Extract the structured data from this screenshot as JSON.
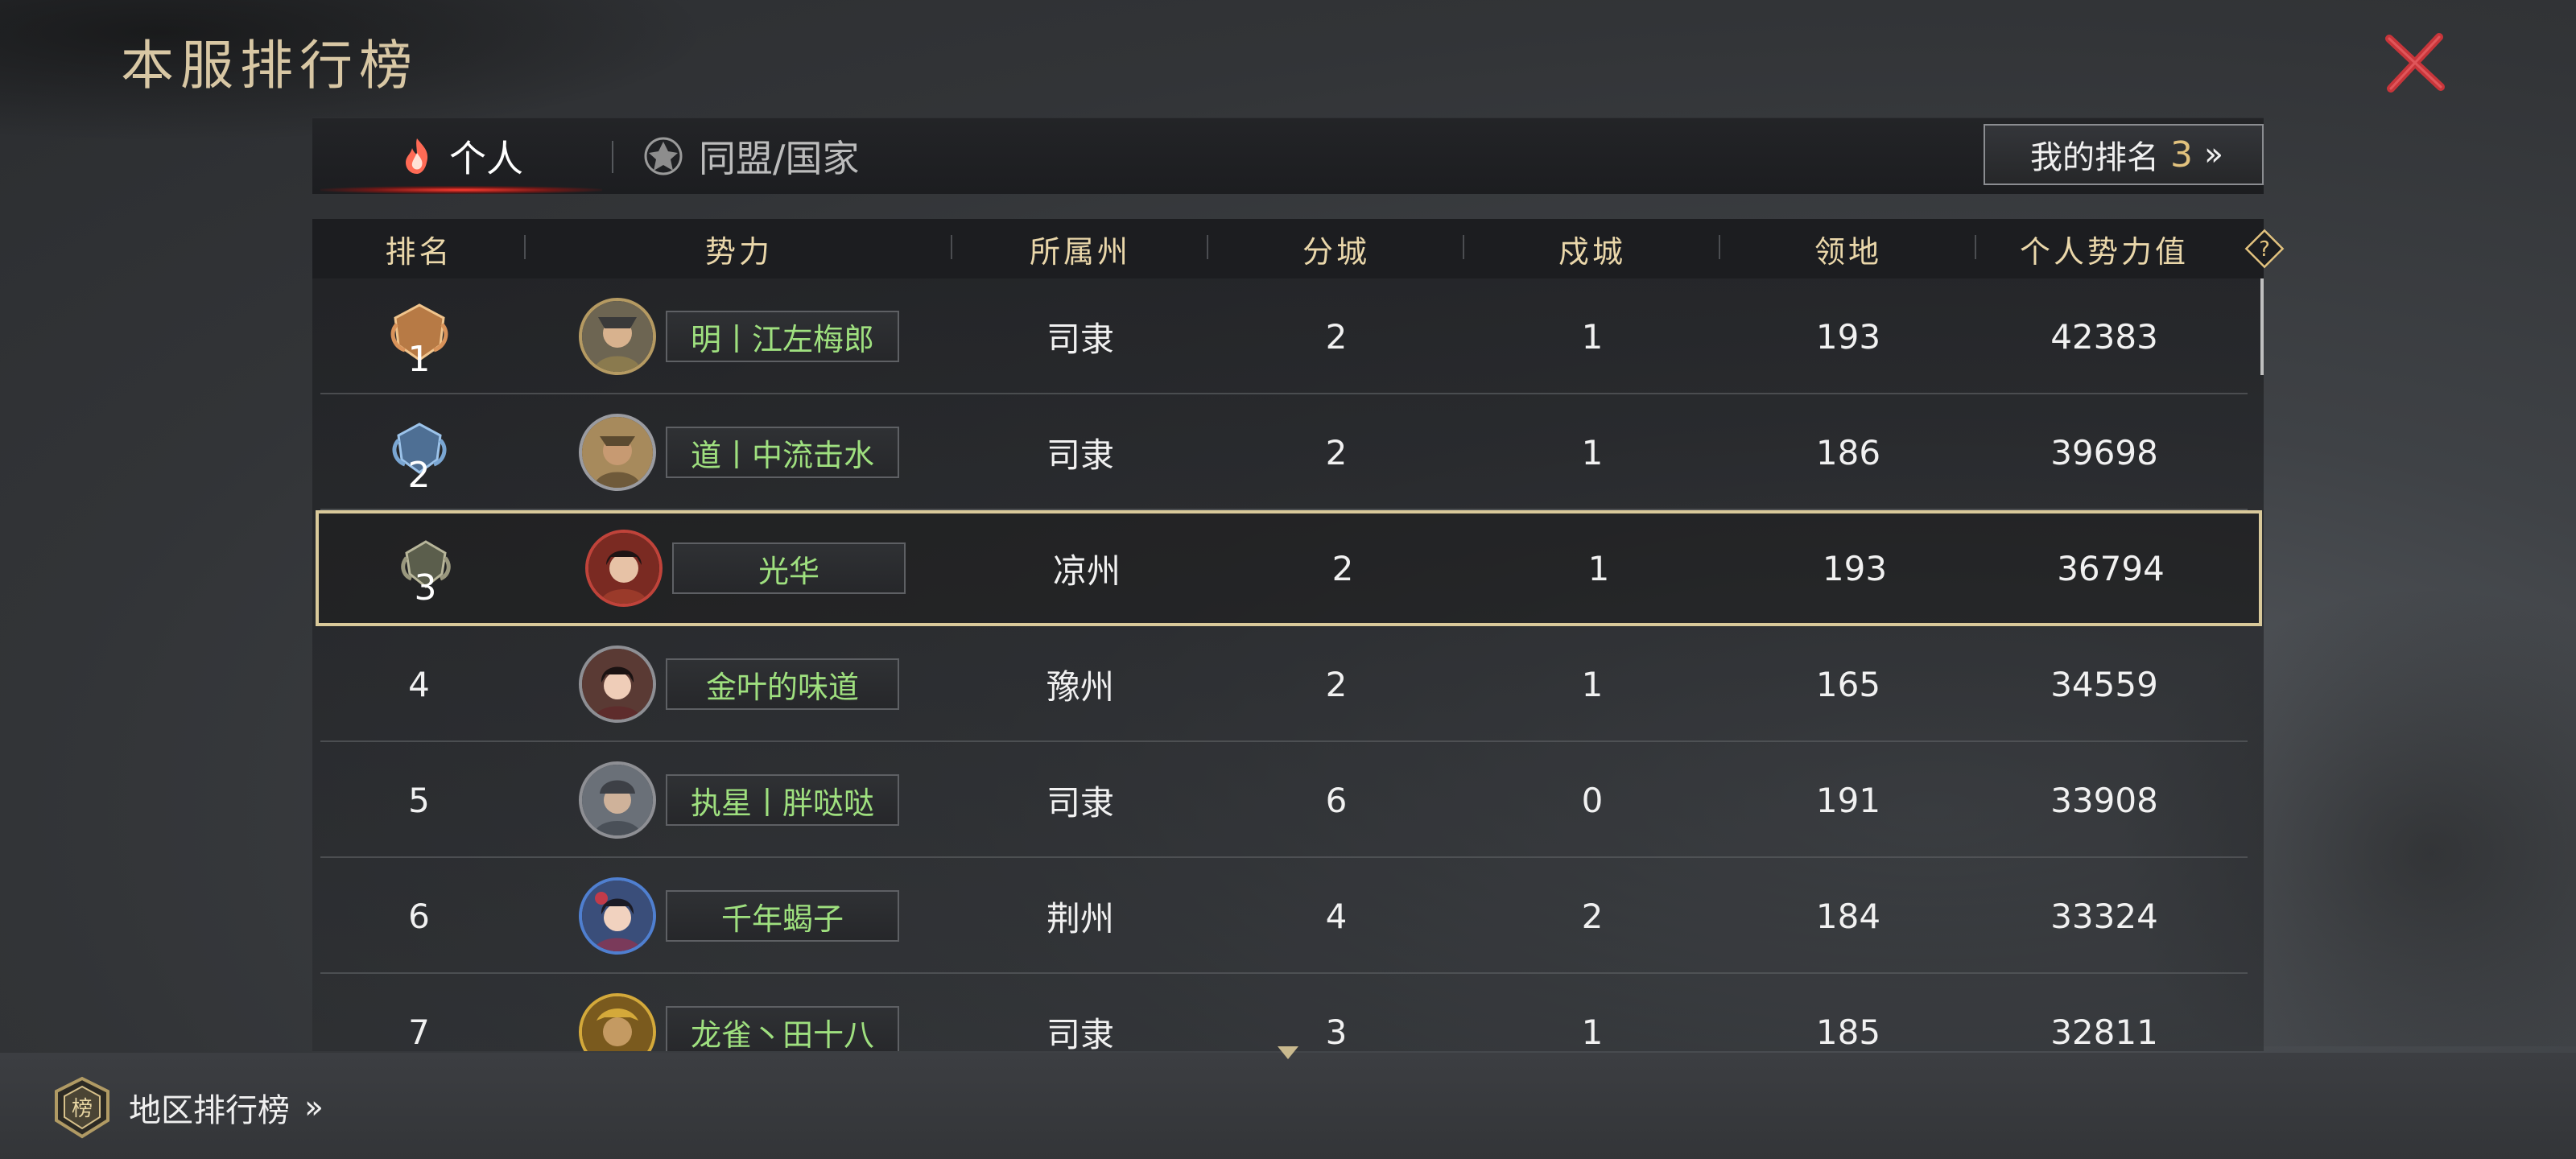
{
  "page_title": "本服排行榜",
  "tabs": [
    {
      "label": "个人",
      "icon": "fire-icon",
      "active": true
    },
    {
      "label": "同盟/国家",
      "icon": "alliance-emblem-icon",
      "active": false
    }
  ],
  "my_rank": {
    "label": "我的排名",
    "value": "3"
  },
  "columns": [
    "排名",
    "势力",
    "所属州",
    "分城",
    "戍城",
    "领地",
    "个人势力值"
  ],
  "rows": [
    {
      "rank": "1",
      "name": "明丨江左梅郎",
      "state": "司隶",
      "branch_cities": "2",
      "garrison": "1",
      "territory": "193",
      "power": "42383"
    },
    {
      "rank": "2",
      "name": "道丨中流击水",
      "state": "司隶",
      "branch_cities": "2",
      "garrison": "1",
      "territory": "186",
      "power": "39698"
    },
    {
      "rank": "3",
      "name": "光华",
      "state": "凉州",
      "branch_cities": "2",
      "garrison": "1",
      "territory": "193",
      "power": "36794"
    },
    {
      "rank": "4",
      "name": "金叶的味道",
      "state": "豫州",
      "branch_cities": "2",
      "garrison": "1",
      "territory": "165",
      "power": "34559"
    },
    {
      "rank": "5",
      "name": "执星丨胖哒哒",
      "state": "司隶",
      "branch_cities": "6",
      "garrison": "0",
      "territory": "191",
      "power": "33908"
    },
    {
      "rank": "6",
      "name": "千年蝎子",
      "state": "荆州",
      "branch_cities": "4",
      "garrison": "2",
      "territory": "184",
      "power": "33324"
    },
    {
      "rank": "7",
      "name": "龙雀丶田十八",
      "state": "司隶",
      "branch_cities": "3",
      "garrison": "1",
      "territory": "185",
      "power": "32811"
    }
  ],
  "region_button": {
    "label": "地区排行榜",
    "icon": "region-rank-badge-icon",
    "badge_char": "榜"
  },
  "colors": {
    "title": "#d8c7a4",
    "header_text": "#ead7aa",
    "name_text": "#9fe07f",
    "highlight_border": "#d9c99a",
    "accent_gold": "#e2c27e",
    "close_red": "#c8353a"
  }
}
